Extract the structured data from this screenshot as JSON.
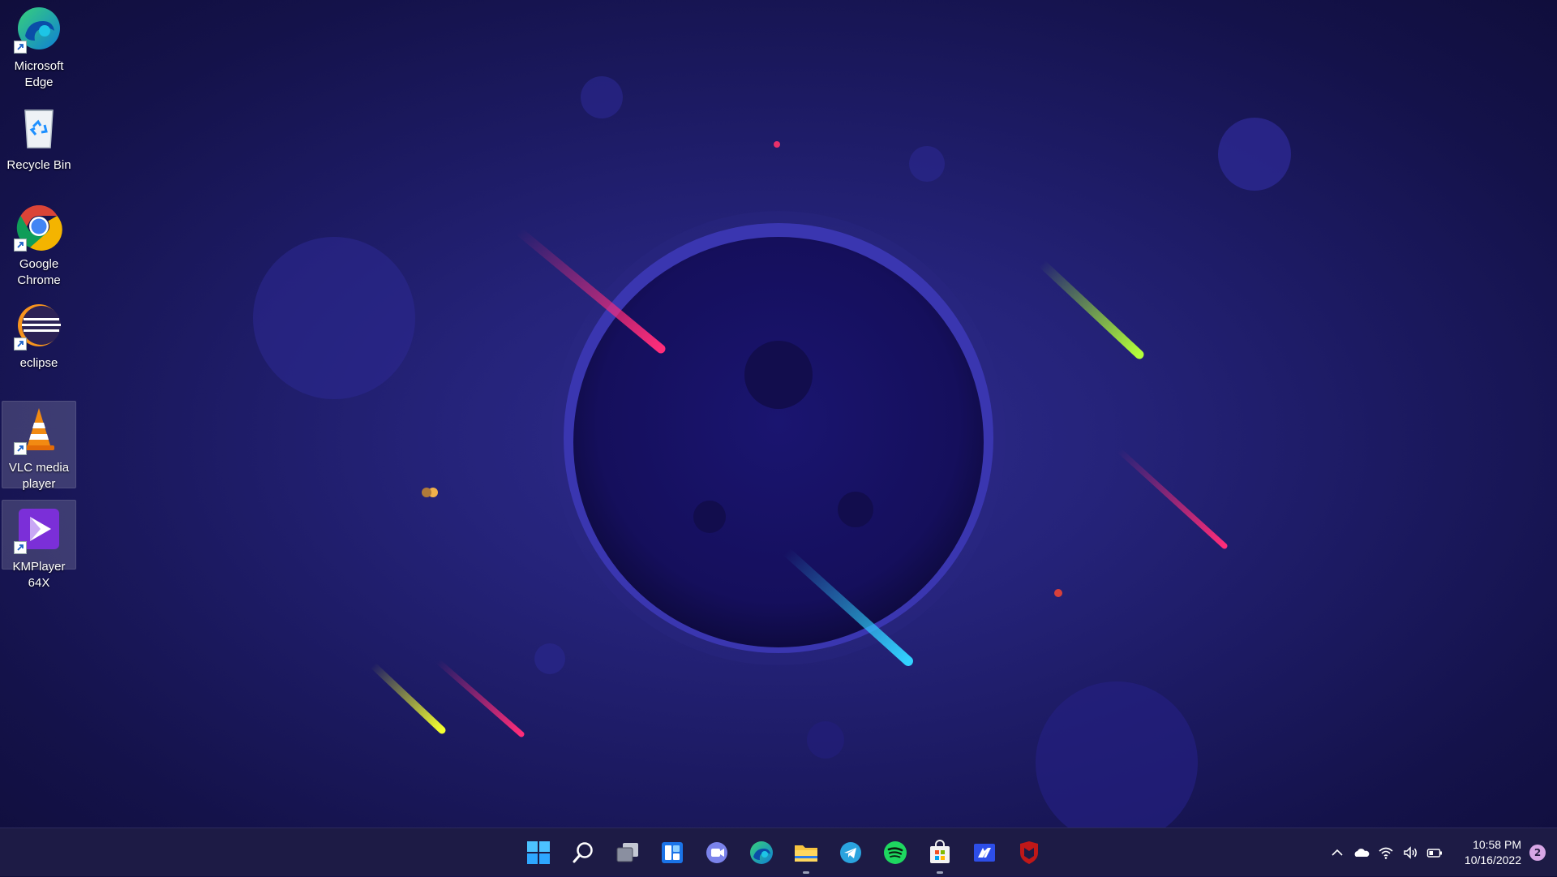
{
  "desktop": {
    "icons": [
      {
        "label": "Microsoft\nEdge",
        "icon": "edge-icon",
        "selected": false
      },
      {
        "label": "Recycle Bin",
        "icon": "recycle-bin-icon",
        "selected": false
      },
      {
        "label": "Google\nChrome",
        "icon": "chrome-icon",
        "selected": false
      },
      {
        "label": "eclipse",
        "icon": "eclipse-icon",
        "selected": false
      },
      {
        "label": "VLC media\nplayer",
        "icon": "vlc-icon",
        "selected": true
      },
      {
        "label": "KMPlayer 64X",
        "icon": "kmplayer-icon",
        "selected": true
      }
    ]
  },
  "taskbar": {
    "pinned": [
      "start-icon",
      "search-icon",
      "task-view-icon",
      "widgets-icon",
      "teams-chat-icon",
      "edge-icon",
      "file-explorer-icon",
      "telegram-icon",
      "spotify-icon",
      "microsoft-store-icon",
      "mail-app-icon",
      "mcafee-icon"
    ],
    "tray": {
      "time": "10:58 PM",
      "date": "10/16/2022",
      "notification_count": "2"
    }
  },
  "colors": {
    "taskbar": "#1d1b45",
    "wallpaper": "#25237a",
    "accent": "#4cc2ff"
  }
}
